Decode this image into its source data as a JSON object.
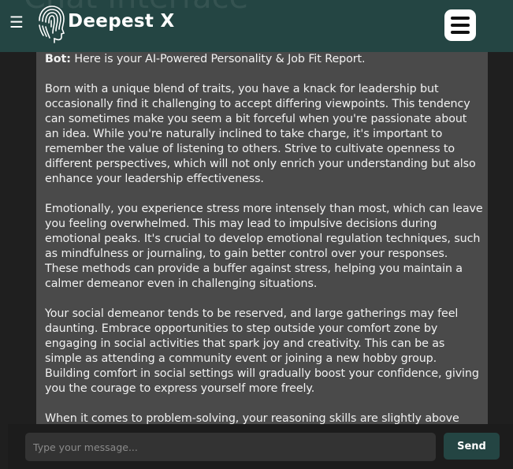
{
  "header": {
    "ghost_title": "Chat Interface",
    "brand": "Deepest X",
    "hamburger_glyph": "☰",
    "logo_icon": "head-fingerprint-icon",
    "menu_icon": "hamburger-icon"
  },
  "chat": {
    "messages": [
      {
        "sender": "Bot:",
        "intro": "Here is your AI-Powered Personality & Job Fit Report.",
        "paragraphs": [
          "Born with a unique blend of traits, you have a knack for leadership but occasionally find it challenging to accept differing viewpoints. This tendency can sometimes make you seem a bit forceful when you're passionate about an idea. While you're naturally inclined to take charge, it's important to remember the value of listening to others. Strive to cultivate openness to different perspectives, which will not only enrich your understanding but also enhance your leadership effectiveness.",
          "Emotionally, you experience stress more intensely than most, which can leave you feeling overwhelmed. This may lead to impulsive decisions during emotional peaks. It's crucial to develop emotional regulation techniques, such as mindfulness or journaling, to gain better control over your responses. These methods can provide a buffer against stress, helping you maintain a calmer demeanor even in challenging situations.",
          "Your social demeanor tends to be reserved, and large gatherings may feel daunting. Embrace opportunities to step outside your comfort zone by engaging in social activities that spark joy and creativity. This can be as simple as attending a community event or joining a new hobby group. Building comfort in social settings will gradually boost your confidence, giving you the courage to express yourself more freely.",
          "When it comes to problem-solving, your reasoning skills are slightly above"
        ]
      }
    ]
  },
  "composer": {
    "placeholder": "Type your message...",
    "value": "",
    "send_label": "Send"
  },
  "colors": {
    "header_bg": "#244543",
    "page_bg": "#1f1f1f",
    "bubble_bg": "#4a4a4a",
    "input_bg": "#333333",
    "accent": "#244543"
  }
}
